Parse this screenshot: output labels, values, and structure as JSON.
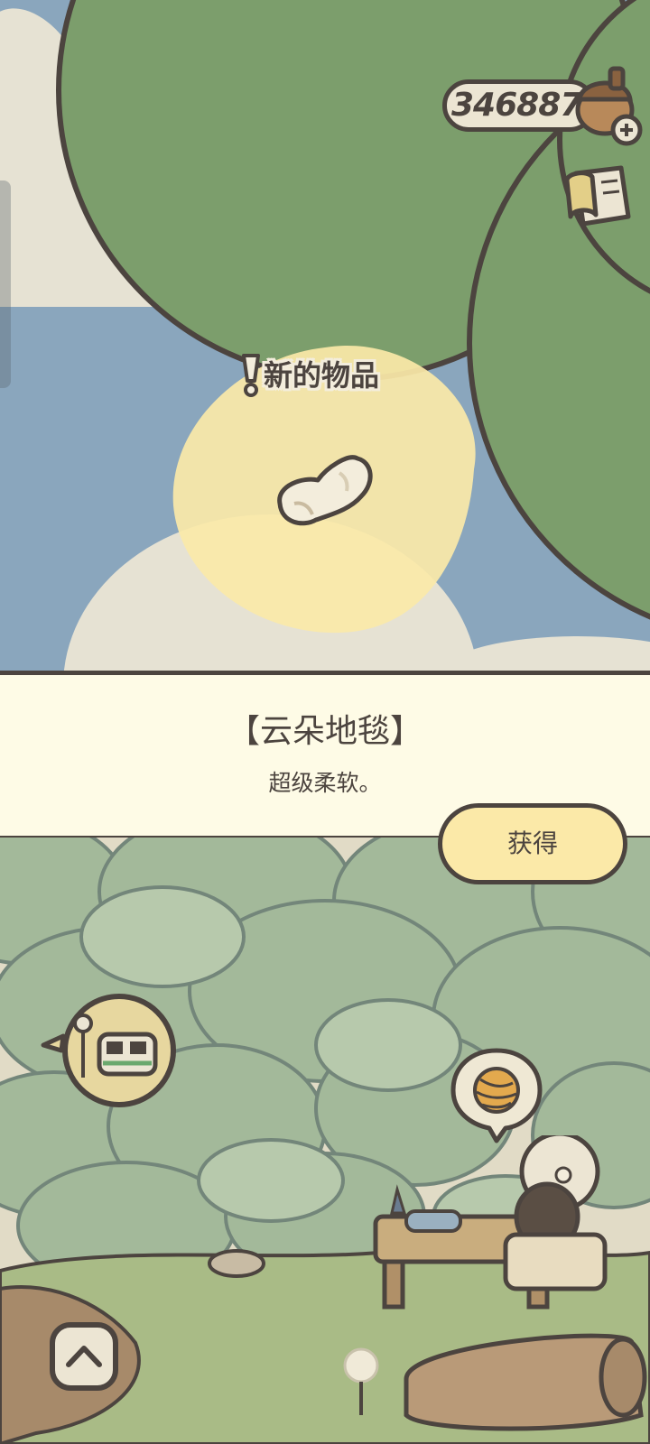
{
  "hud": {
    "currency_amount": "346887",
    "currency_icon": "acorn-icon",
    "add_currency_icon": "plus-icon",
    "journal_icon": "book-icon"
  },
  "new_item": {
    "label": "新的物品",
    "marker_icon": "exclamation-icon",
    "item_icon": "cloud-rug-icon"
  },
  "item_info": {
    "name": "【云朵地毯】",
    "description": "超级柔软。",
    "obtain_label": "获得"
  },
  "scene": {
    "speech_bubbles": [
      "train-station-icon",
      "yarn-ball-icon"
    ],
    "expand_icon": "chevron-up-icon"
  },
  "colors": {
    "outline": "#4c443f",
    "leaf_green": "#7c9e6c",
    "sky": "#8aa6bd",
    "glow": "#fbe9a8",
    "banner": "#fefbe6"
  }
}
